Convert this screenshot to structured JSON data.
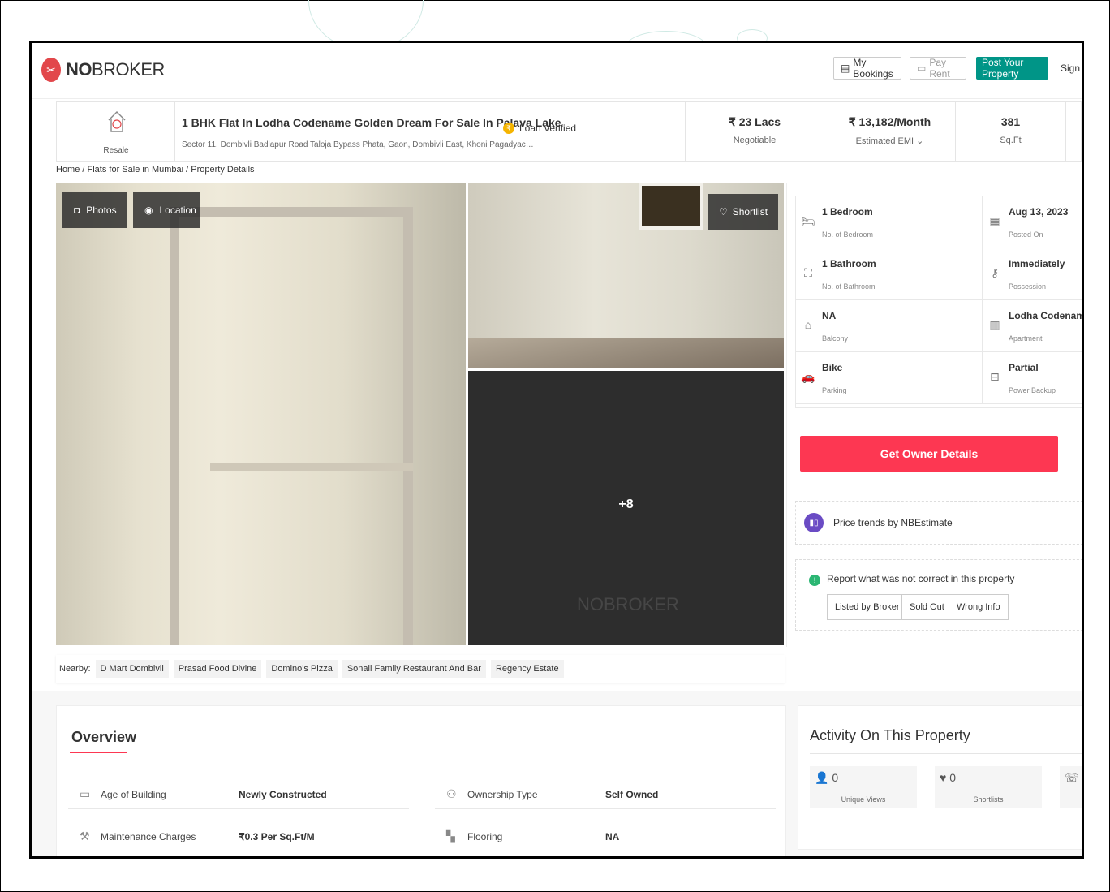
{
  "header": {
    "logo_no": "NO",
    "logo_broker": "BROKER",
    "my_bookings": "My Bookings",
    "pay_rent": "Pay Rent",
    "post_property": "Post Your Property",
    "sign_up": "Sign up"
  },
  "listing": {
    "type_label": "Resale",
    "title": "1 BHK Flat In Lodha Codename Golden Dream For Sale In Palava Lake",
    "address": "Sector 11, Dombivli Badlapur Road Taloja Bypass Phata, Gaon, Dombivli East, Khoni Pagadyac…",
    "loan_verified": "Loan Verified",
    "price": "₹ 23 Lacs",
    "price_sub": "Negotiable",
    "emi": "₹ 13,182/Month",
    "emi_sub": "Estimated EMI ⌄",
    "area": "381",
    "area_unit": "Sq.Ft"
  },
  "breadcrumb": "Home / Flats for Sale in Mumbai / Property Details",
  "gallery": {
    "photos_label": "Photos",
    "location_label": "Location",
    "shortlist_label": "Shortlist",
    "more_count": "+8",
    "watermark": "NOBROKER"
  },
  "nearby": {
    "label": "Nearby:",
    "places": [
      "D Mart Dombivli",
      "Prasad Food Divine",
      "Domino's Pizza",
      "Sonali Family Restaurant And Bar",
      "Regency Estate"
    ]
  },
  "specs": [
    {
      "value": "1 Bedroom",
      "label": "No. of Bedroom",
      "icon": "bed-icon"
    },
    {
      "value": "Aug 13, 2023",
      "label": "Posted On",
      "icon": "calendar-icon"
    },
    {
      "value": "1 Bathroom",
      "label": "No. of Bathroom",
      "icon": "bathtub-icon"
    },
    {
      "value": "Immediately",
      "label": "Possession",
      "icon": "key-icon"
    },
    {
      "value": "NA",
      "label": "Balcony",
      "icon": "balcony-icon"
    },
    {
      "value": "Lodha Codename G",
      "label": "Apartment",
      "icon": "building-icon"
    },
    {
      "value": "Bike",
      "label": "Parking",
      "icon": "car-icon"
    },
    {
      "value": "Partial",
      "label": "Power Backup",
      "icon": "power-backup-icon"
    }
  ],
  "actions": {
    "get_owner": "Get Owner Details",
    "price_trends": "Price trends by NBEstimate",
    "report_title": "Report what was not correct in this property",
    "report_buttons": [
      "Listed by Broker",
      "Sold Out",
      "Wrong Info"
    ]
  },
  "overview": {
    "title": "Overview",
    "rows": [
      {
        "label": "Age of Building",
        "value": "Newly Constructed",
        "icon": "building-age-icon"
      },
      {
        "label": "Ownership Type",
        "value": "Self Owned",
        "icon": "ownership-icon"
      },
      {
        "label": "Maintenance Charges",
        "value": "₹0.3 Per Sq.Ft/M",
        "icon": "maintenance-icon"
      },
      {
        "label": "Flooring",
        "value": "NA",
        "icon": "flooring-icon"
      }
    ]
  },
  "activity": {
    "title": "Activity On This Property",
    "stats": [
      {
        "value": "0",
        "label": "Unique Views",
        "icon": "person-icon"
      },
      {
        "value": "0",
        "label": "Shortlists",
        "icon": "heart-icon"
      },
      {
        "value": "0",
        "label": "",
        "icon": "phone-icon"
      }
    ]
  },
  "colors": {
    "brand_red": "#fd3752",
    "teal": "#009587",
    "purple": "#6a4bc4",
    "green": "#2bb673"
  }
}
